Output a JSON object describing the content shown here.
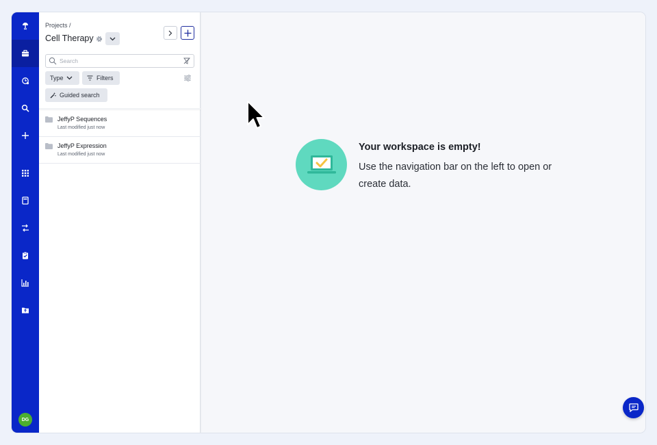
{
  "rail": {
    "items": [
      {
        "icon": "lightbulb-logo-icon"
      },
      {
        "icon": "briefcase-icon"
      },
      {
        "icon": "history-icon"
      },
      {
        "icon": "search-icon"
      },
      {
        "icon": "plus-icon"
      },
      {
        "icon": "apps-grid-icon"
      },
      {
        "icon": "notebook-icon"
      },
      {
        "icon": "workflow-icon"
      },
      {
        "icon": "clipboard-check-icon"
      },
      {
        "icon": "bar-chart-icon"
      },
      {
        "icon": "folder-upload-icon"
      }
    ],
    "active_index": 1,
    "avatar_initials": "DG",
    "colors": {
      "rail": "#0a27c8",
      "active": "#0a1fa0",
      "avatar": "#4caf2f"
    }
  },
  "panel": {
    "breadcrumb": "Projects /",
    "title": "Cell Therapy",
    "search": {
      "placeholder": "Search",
      "value": ""
    },
    "filters": {
      "type_label": "Type",
      "filters_label": "Filters",
      "guided_label": "Guided search"
    },
    "items": [
      {
        "name": "JeffyP Sequences",
        "meta": "Last modified just now"
      },
      {
        "name": "JeffyP Expression",
        "meta": "Last modified just now"
      }
    ]
  },
  "main": {
    "empty_title": "Your workspace is empty!",
    "empty_description": "Use the navigation bar on the left to open or create data.",
    "illustration_color": "#5fd9bf",
    "chat_button_icon": "chat-icon"
  }
}
